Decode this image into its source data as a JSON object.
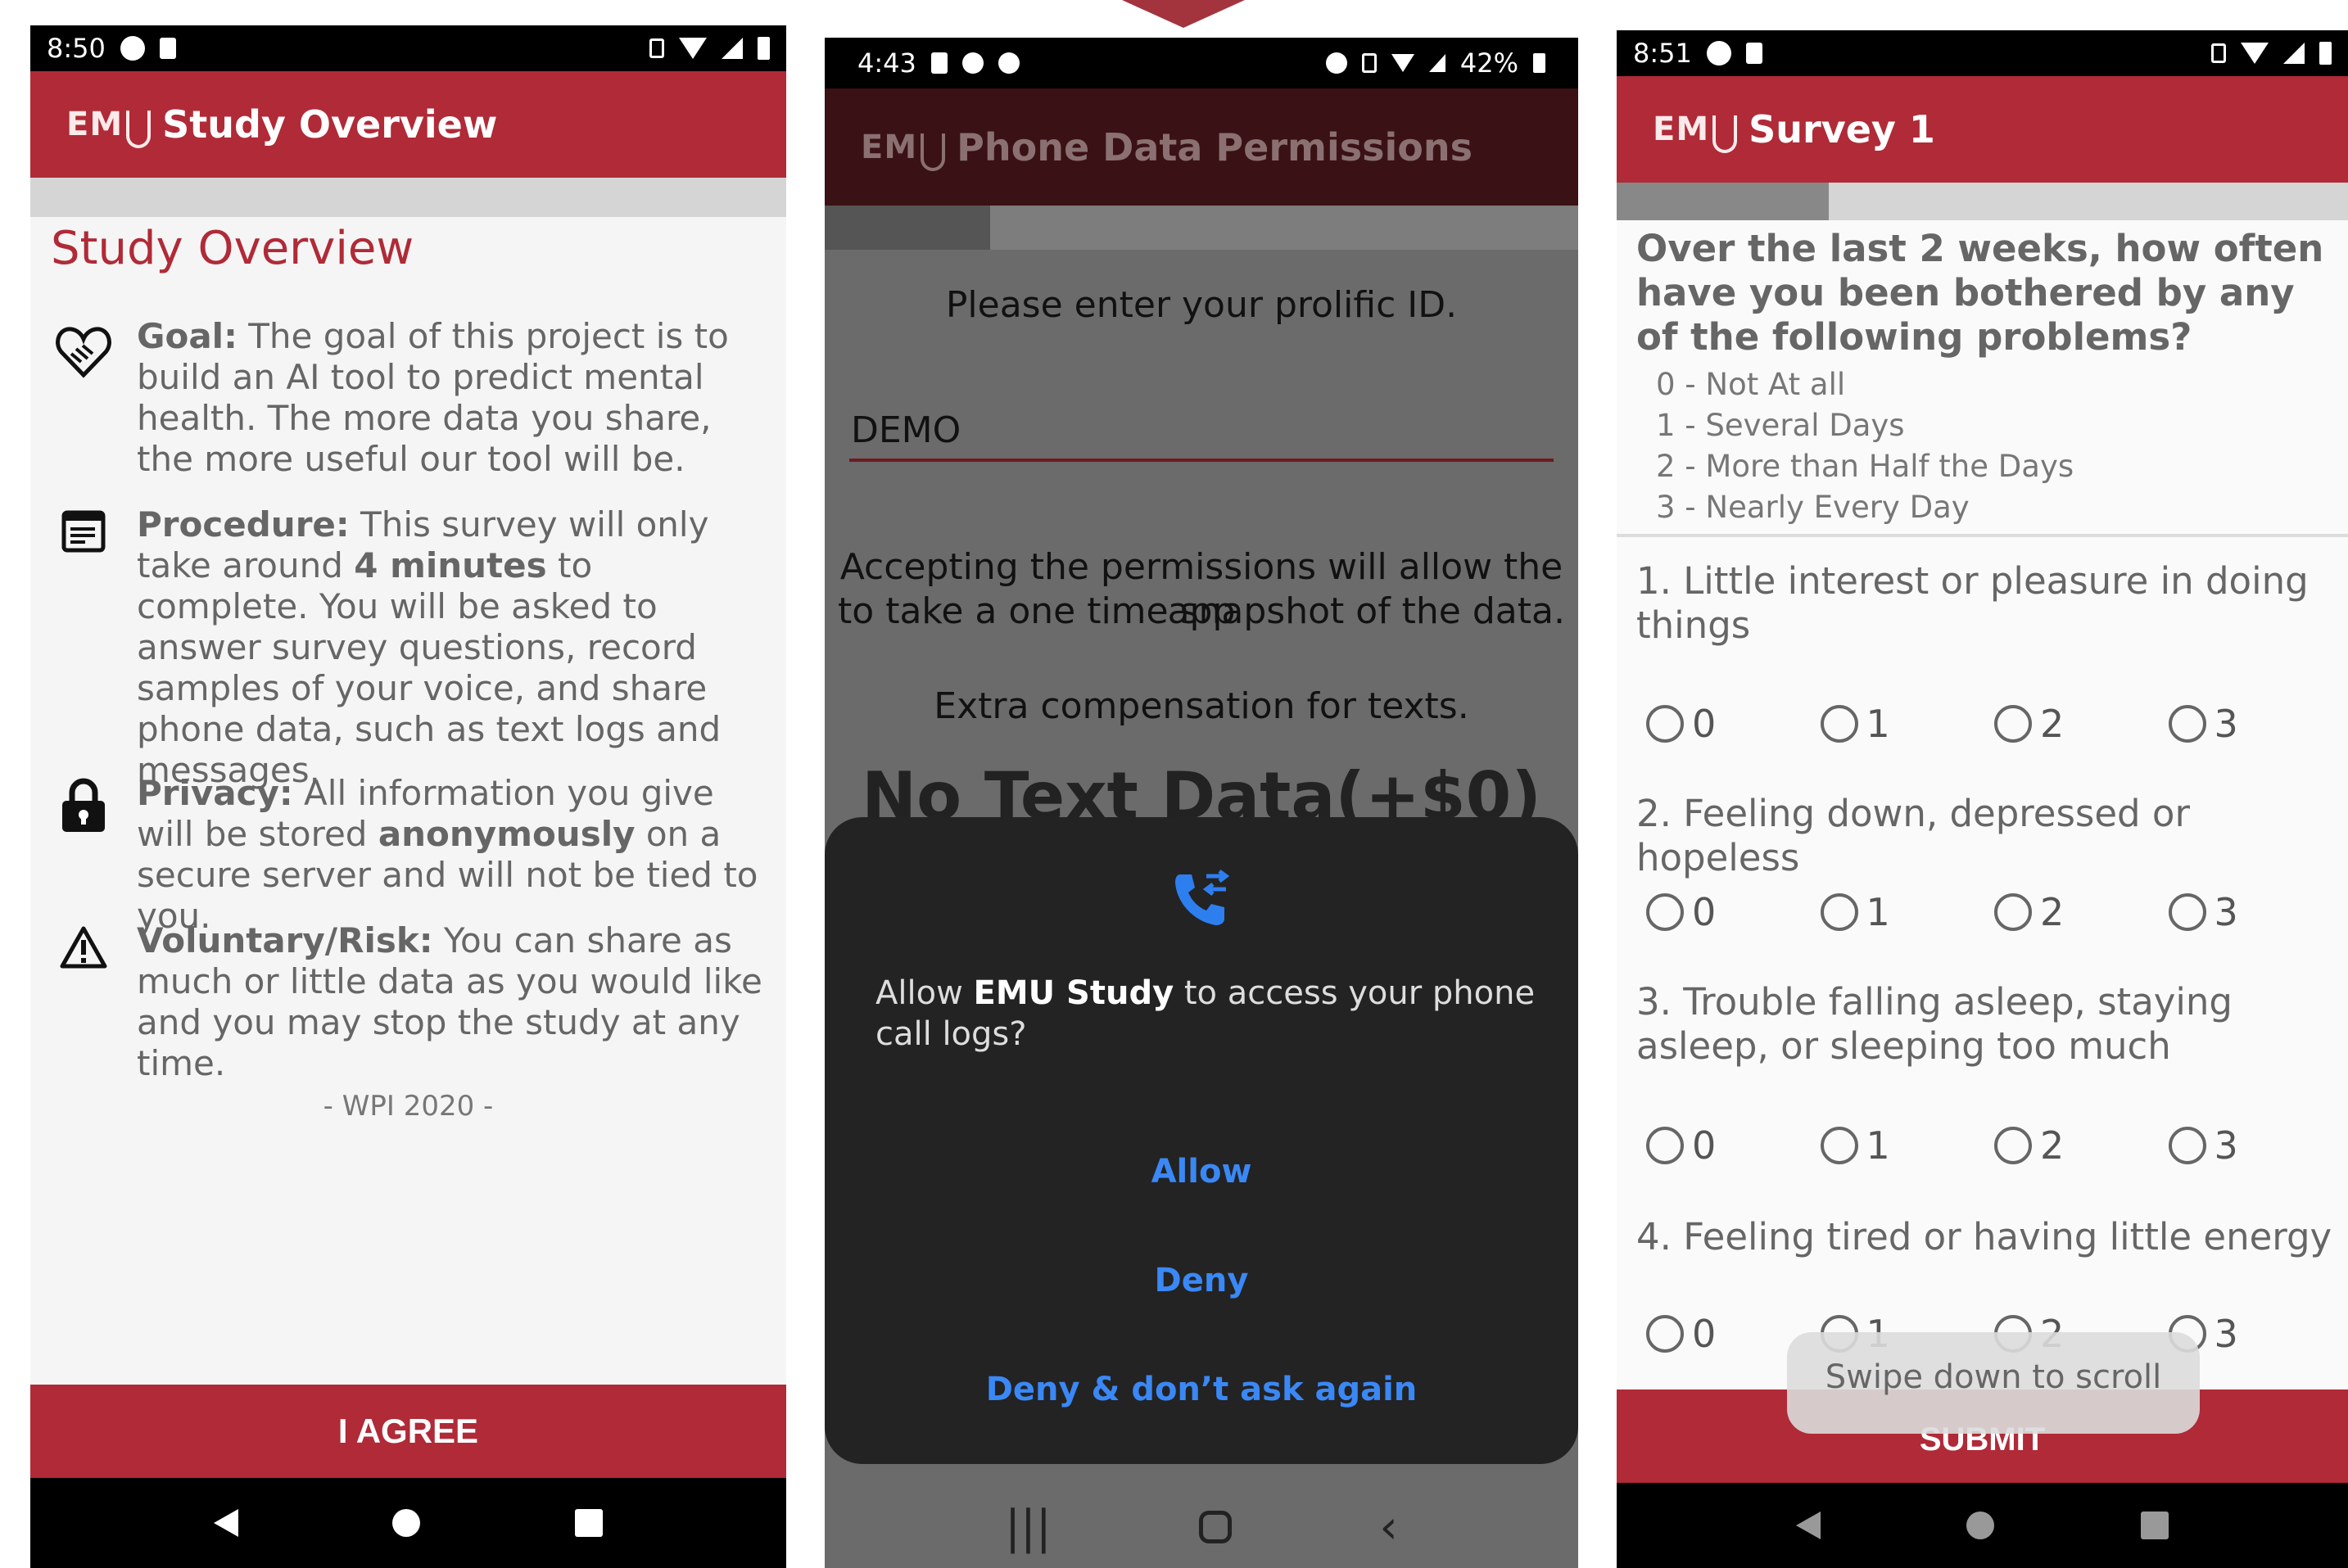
{
  "screen1": {
    "status": {
      "time": "8:50"
    },
    "app_title": "Study Overview",
    "logo_text": "EM",
    "heading": "Study Overview",
    "items": [
      {
        "icon": "handshake-heart-icon",
        "label": "Goal:",
        "text": " The goal of this project is to build an AI tool to predict mental health. The more data you share, the more useful our tool will be."
      },
      {
        "icon": "notes-icon",
        "label": "Procedure:",
        "text1": " This survey will only take around ",
        "bold": "4 minutes",
        "text2": " to complete. You will be asked to answer survey questions, record samples of your voice, and share phone data, such as text logs and messages."
      },
      {
        "icon": "lock-icon",
        "label": "Privacy:",
        "text1": " All information you give will be stored ",
        "bold": "anonymously",
        "text2": " on a secure server and will not be tied to you."
      },
      {
        "icon": "warning-icon",
        "label": "Voluntary/Risk:",
        "text": " You can share as much or little data as you would like and you may stop the study at any time."
      }
    ],
    "signature": "- WPI 2020 -",
    "agree_label": "I AGREE"
  },
  "screen2": {
    "status": {
      "time": "4:43",
      "battery": "42%"
    },
    "app_title": "Phone Data Permissions",
    "logo_text": "EM",
    "prompt": "Please enter your prolific ID.",
    "id_value": "DEMO",
    "info_line1": "Accepting the permissions will allow the app",
    "info_line2": "to take a one time snapshot of the data.",
    "compensation": "Extra compensation for texts.",
    "no_text": "No Text Data(+$0)",
    "dialog": {
      "icon": "phone-call-logs-icon",
      "msg_pre": "Allow ",
      "msg_app": "EMU Study",
      "msg_post": " to access your phone call logs?",
      "allow": "Allow",
      "deny": "Deny",
      "deny_forever": "Deny & don’t ask again"
    }
  },
  "screen3": {
    "status": {
      "time": "8:51"
    },
    "app_title": "Survey 1",
    "logo_text": "EM",
    "progress": 0.29,
    "question_header": "Over the last 2 weeks, how often have you been bothered by any of the following problems?",
    "scale": [
      "0 - Not At all",
      "1 - Several Days",
      "2 - More than Half the Days",
      "3 - Nearly Every Day"
    ],
    "questions": [
      "1. Little interest or pleasure in doing things",
      "2. Feeling down, depressed or hopeless",
      "3. Trouble falling asleep, staying asleep, or sleeping too much",
      "4. Feeling tired or having little energy"
    ],
    "options": [
      "0",
      "1",
      "2",
      "3"
    ],
    "toast": "Swipe down to scroll",
    "submit_label": "SUBMIT"
  }
}
